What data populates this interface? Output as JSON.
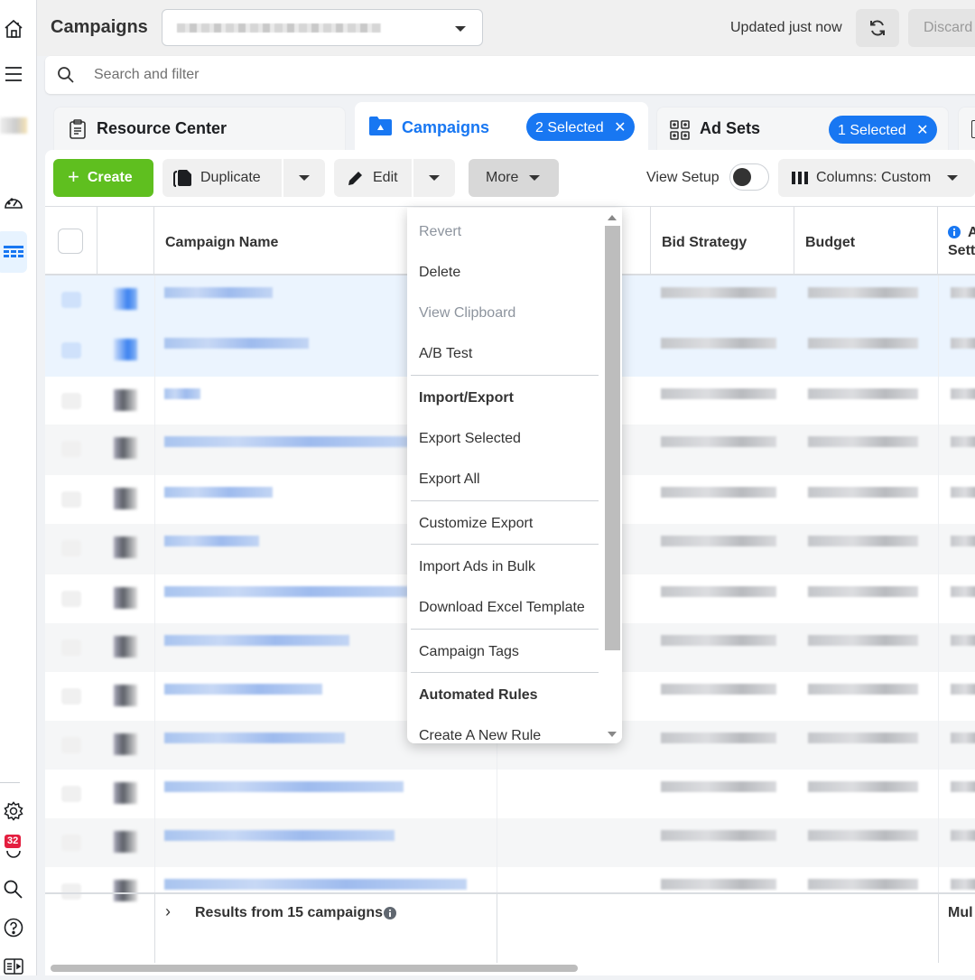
{
  "sidebar": {
    "icons": [
      "home-icon",
      "menu-icon",
      "account-avatar",
      "performance-icon",
      "campaigns-table-icon",
      "settings-icon",
      "notifications-icon",
      "search-icon",
      "help-icon",
      "reports-icon"
    ],
    "notification_count": "32"
  },
  "header": {
    "title": "Campaigns",
    "account_selector_value": "",
    "updated_status": "Updated just now",
    "discard_label": "Discard"
  },
  "search": {
    "placeholder": "Search and filter"
  },
  "tabs": [
    {
      "label": "Resource Center",
      "icon": "clipboard-icon",
      "active": false
    },
    {
      "label": "Campaigns",
      "icon": "folder-icon",
      "active": true,
      "selected_badge": "2 Selected"
    },
    {
      "label": "Ad Sets",
      "icon": "grid-icon",
      "active": false,
      "selected_badge": "1 Selected"
    }
  ],
  "toolbar": {
    "create_label": "Create",
    "duplicate_label": "Duplicate",
    "edit_label": "Edit",
    "more_label": "More",
    "view_setup_label": "View Setup",
    "view_setup_on": false,
    "columns_label": "Columns: Custom"
  },
  "table": {
    "columns": [
      "Campaign Name",
      "Bid Strategy",
      "Budget",
      "Attribution Setting"
    ],
    "column_header_partial": "A",
    "column_header_partial_line2": "Sett",
    "row_count_visible": 13,
    "selected_rows": [
      0,
      1
    ],
    "footer_label": "Results from 15 campaigns",
    "footer_right_partial": "Mul"
  },
  "more_menu": {
    "items": [
      {
        "label": "Revert",
        "type": "disabled"
      },
      {
        "label": "Delete",
        "type": "item"
      },
      {
        "label": "View Clipboard",
        "type": "disabled"
      },
      {
        "label": "A/B Test",
        "type": "item"
      },
      {
        "label": "Import/Export",
        "type": "header"
      },
      {
        "label": "Export Selected",
        "type": "item"
      },
      {
        "label": "Export All",
        "type": "item"
      },
      {
        "label": "Customize Export",
        "type": "item"
      },
      {
        "label": "Import Ads in Bulk",
        "type": "item"
      },
      {
        "label": "Download Excel Template",
        "type": "item"
      },
      {
        "label": "Campaign Tags",
        "type": "item"
      },
      {
        "label": "Automated Rules",
        "type": "header"
      },
      {
        "label": "Create A New Rule",
        "type": "item"
      }
    ]
  },
  "colors": {
    "accent": "#1877f2",
    "create_button": "#5fbf1f",
    "selected_row": "#ebf4fe",
    "badge": "#e41e3f"
  }
}
